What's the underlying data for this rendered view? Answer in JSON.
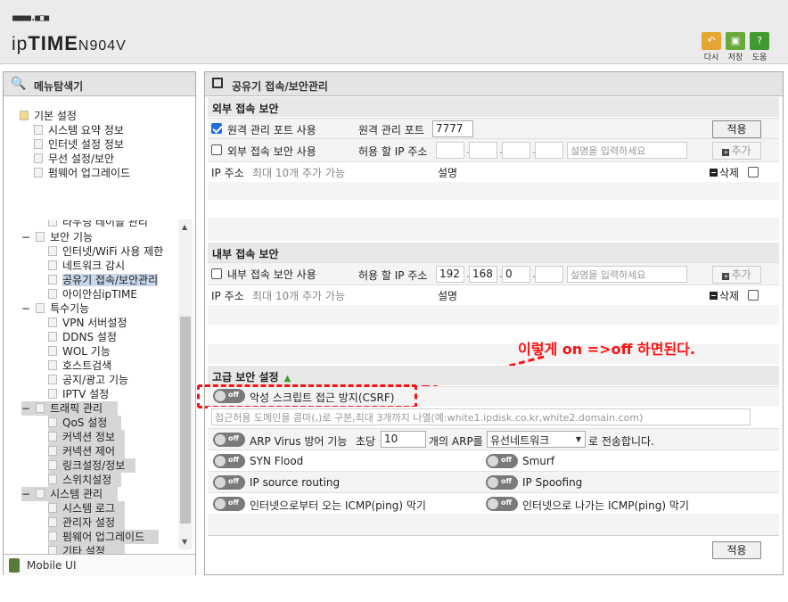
{
  "header": {
    "logo_dots": "■■■■.■□■",
    "brand_prefix": "ip",
    "brand_bold": "TIME",
    "model": "N904V",
    "buttons": [
      {
        "label": "다시",
        "icon": "undo-icon",
        "color": "#e0a030"
      },
      {
        "label": "저장",
        "icon": "save-icon",
        "color": "#5aa02c"
      },
      {
        "label": "도움",
        "icon": "help-icon",
        "color": "#3a8f2a"
      }
    ]
  },
  "sidebar": {
    "title": "메뉴탐색기",
    "items": [
      {
        "label": "기본 설정",
        "level": 0,
        "state": "",
        "icon": "home-icon"
      },
      {
        "label": "시스템 요약 정보",
        "level": 1,
        "state": ""
      },
      {
        "label": "인터넷 설정 정보",
        "level": 1,
        "state": ""
      },
      {
        "label": "무선 설정/보안",
        "level": 1,
        "state": ""
      },
      {
        "label": "펌웨어 업그레이드",
        "level": 1,
        "state": ""
      },
      {
        "label": "라우팅 테이블 관리",
        "level": 1,
        "state": ""
      },
      {
        "label": "보안 기능",
        "level": 0,
        "state": "−"
      },
      {
        "label": "인터넷/WiFi 사용 제한",
        "level": 1,
        "state": ""
      },
      {
        "label": "네트워크 감시",
        "level": 1,
        "state": ""
      },
      {
        "label": "공유기 접속/보안관리",
        "level": 1,
        "state": "selected"
      },
      {
        "label": "아이안심ipTIME",
        "level": 1,
        "state": ""
      },
      {
        "label": "특수기능",
        "level": 0,
        "state": "−"
      },
      {
        "label": "VPN 서버설정",
        "level": 1,
        "state": ""
      },
      {
        "label": "DDNS 설정",
        "level": 1,
        "state": ""
      },
      {
        "label": "WOL 기능",
        "level": 1,
        "state": ""
      },
      {
        "label": "호스트검색",
        "level": 1,
        "state": ""
      },
      {
        "label": "공지/광고 기능",
        "level": 1,
        "state": ""
      },
      {
        "label": "IPTV 설정",
        "level": 1,
        "state": ""
      },
      {
        "label": "트래픽 관리",
        "level": 0,
        "state": "−"
      },
      {
        "label": "QoS 설정",
        "level": 1,
        "state": ""
      },
      {
        "label": "커넥션 정보",
        "level": 1,
        "state": ""
      },
      {
        "label": "커넥션 제어",
        "level": 1,
        "state": ""
      },
      {
        "label": "링크설정/정보",
        "level": 1,
        "state": ""
      },
      {
        "label": "스위치설정",
        "level": 1,
        "state": ""
      },
      {
        "label": "시스템 관리",
        "level": 0,
        "state": "−"
      },
      {
        "label": "시스템 로그",
        "level": 1,
        "state": ""
      },
      {
        "label": "관리자 설정",
        "level": 1,
        "state": ""
      },
      {
        "label": "펌웨어 업그레이드",
        "level": 1,
        "state": ""
      },
      {
        "label": "기타 설정",
        "level": 1,
        "state": ""
      }
    ],
    "mobile_label": "Mobile UI"
  },
  "main": {
    "title": "공유기 접속/보안관리",
    "external": {
      "title": "외부 접속 보안",
      "remote_port_checkbox": "원격 관리 포트 사용",
      "remote_port_label": "원격 관리 포트",
      "remote_port_value": "7777",
      "apply_label": "적용",
      "ext_security_checkbox": "외부 접속 보안 사용",
      "allowed_ip_label": "허용 할 IP 주소",
      "desc_placeholder": "설명을 입력하세요",
      "add_label": "추가",
      "ip_col": "IP 주소",
      "ip_hint": "최대 10개 추가 가능",
      "desc_col": "설명",
      "delete_label": "삭제"
    },
    "internal": {
      "title": "내부 접속 보안",
      "int_security_checkbox": "내부 접속 보안 사용",
      "allowed_ip_label": "허용 할 IP 주소",
      "ip1": "192",
      "ip2": "168",
      "ip3": "0",
      "ip4": "",
      "desc_placeholder": "설명을 입력하세요",
      "add_label": "추가",
      "ip_col": "IP 주소",
      "ip_hint": "최대 10개 추가 가능",
      "desc_col": "설명",
      "delete_label": "삭제"
    },
    "annotation": "이렇게 on =>off 하면된다.",
    "advanced": {
      "title": "고급 보안 설정",
      "toggle_text": "off",
      "csrf_label": "악성 스크립트 접근 방지(CSRF)",
      "domain_placeholder": "접근허용 도메인을 콤마(,)로 구분,최대 3개까지 나열(예:white1.ipdisk.co.kr,white2.domain.com)",
      "arp_label": "ARP Virus 방어 기능",
      "arp_per_sec": "초당",
      "arp_value": "10",
      "arp_suffix": "개의 ARP를",
      "arp_select": "유선네트워크",
      "arp_tail": "로 전송합니다.",
      "syn_flood": "SYN Flood",
      "smurf": "Smurf",
      "ip_source_routing": "IP source routing",
      "ip_spoofing": "IP Spoofing",
      "icmp_in": "인터넷으로부터 오는 ICMP(ping) 막기",
      "icmp_out": "인터넷으로 나가는 ICMP(ping) 막기",
      "apply_label": "적용"
    }
  }
}
